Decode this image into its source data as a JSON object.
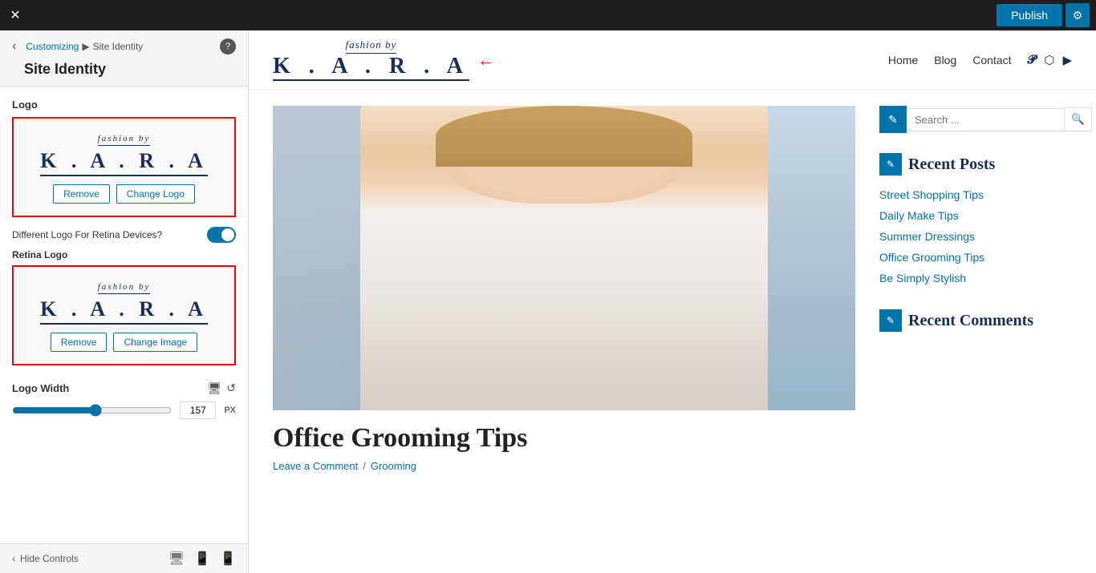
{
  "topbar": {
    "publish_label": "Publish",
    "gear_icon": "⚙",
    "close_icon": "✕"
  },
  "sidebar": {
    "breadcrumb_customizing": "Customizing",
    "breadcrumb_separator": "▶",
    "breadcrumb_page": "Site Identity",
    "help_icon": "?",
    "back_icon": "‹",
    "section_title": "Site Identity",
    "logo_label": "Logo",
    "remove_btn": "Remove",
    "change_logo_btn": "Change Logo",
    "retina_toggle_label": "Different Logo For Retina Devices?",
    "retina_logo_label": "Retina Logo",
    "remove_retina_btn": "Remove",
    "change_image_btn": "Change Image",
    "logo_width_label": "Logo Width",
    "logo_width_value": "157",
    "logo_width_unit": "PX",
    "hide_controls_label": "Hide Controls",
    "logo_script": "fashion by",
    "logo_block": "K . A . R . A"
  },
  "site_header": {
    "logo_script": "fashion by",
    "logo_block": "K . A . R . A",
    "nav_home": "Home",
    "nav_blog": "Blog",
    "nav_contact": "Contact"
  },
  "article": {
    "title": "Office Grooming Tips",
    "leave_comment": "Leave a Comment",
    "separator": "/",
    "category": "Grooming"
  },
  "sidebar_widgets": {
    "search_placeholder": "Search ...",
    "recent_posts_title": "Recent Posts",
    "recent_posts": [
      "Street Shopping Tips",
      "Daily Make Tips",
      "Summer Dressings",
      "Office Grooming Tips",
      "Be Simply Stylish"
    ],
    "recent_comments_title": "Recent Comments"
  }
}
